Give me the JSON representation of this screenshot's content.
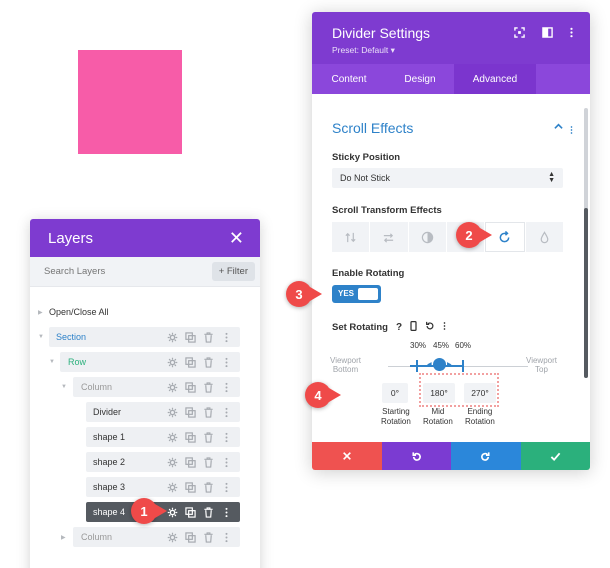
{
  "colors": {
    "purple": "#7e3bd0",
    "blue": "#2e82c9",
    "pink_square": "#f75ca8",
    "cancel_red": "#ef5250",
    "undo_purple": "#7b3bd2",
    "redo_blue": "#2b87da",
    "save_green": "#2bb07c",
    "callout_red": "#ef4a49"
  },
  "layers": {
    "title": "Layers",
    "search_placeholder": "Search Layers",
    "filter_label": "+ Filter",
    "open_close": "Open/Close All",
    "items": [
      {
        "label": "Section"
      },
      {
        "label": "Row"
      },
      {
        "label": "Column"
      },
      {
        "label": "Divider"
      },
      {
        "label": "shape 1"
      },
      {
        "label": "shape 2"
      },
      {
        "label": "shape 3"
      },
      {
        "label": "shape 4"
      },
      {
        "label": "Column"
      }
    ]
  },
  "settings": {
    "title": "Divider Settings",
    "preset": "Preset: Default ▾",
    "tabs": [
      {
        "label": "Content"
      },
      {
        "label": "Design"
      },
      {
        "label": "Advanced"
      }
    ],
    "section_title": "Scroll Effects",
    "sticky_label": "Sticky Position",
    "sticky_value": "Do Not Stick",
    "transform_label": "Scroll Transform Effects",
    "enable_label": "Enable Rotating",
    "toggle_value": "YES",
    "set_rotating_label": "Set Rotating",
    "percent_start": "30%",
    "percent_mid": "45%",
    "percent_end": "60%",
    "viewport_bottom": "Viewport\nBottom",
    "viewport_top": "Viewport\nTop",
    "start_value": "0°",
    "mid_value": "180°",
    "end_value": "270°",
    "start_caption": "Starting\nRotation",
    "mid_caption": "Mid\nRotation",
    "end_caption": "Ending\nRotation"
  },
  "callouts": [
    "1",
    "2",
    "3",
    "4"
  ]
}
